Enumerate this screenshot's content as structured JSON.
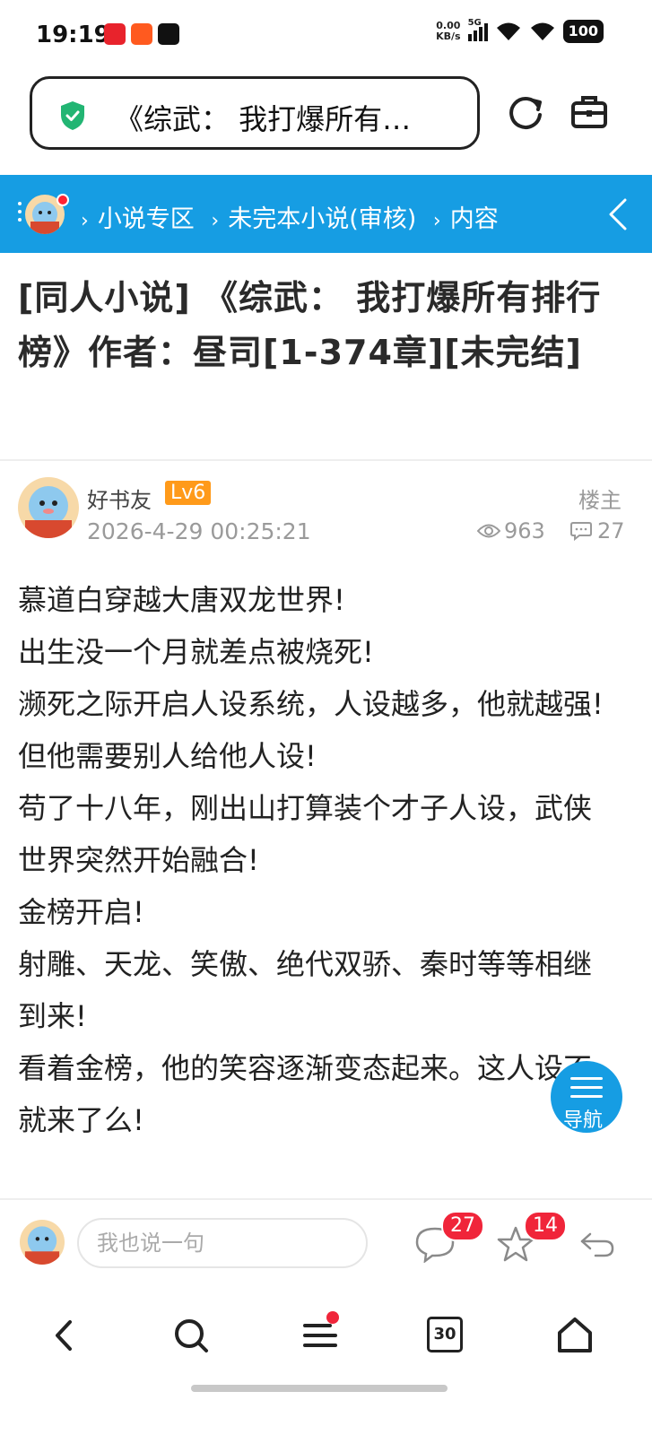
{
  "status": {
    "time": "19:19",
    "net_speed_value": "0.00",
    "net_speed_unit": "KB/s",
    "signal": "5G",
    "battery": "100"
  },
  "address_bar": {
    "url_text": "《综武： 我打爆所有…"
  },
  "breadcrumb": {
    "items": [
      "小说专区",
      "未完本小说(审核)",
      "内容"
    ]
  },
  "post": {
    "title": "[同人小说] 《综武： 我打爆所有排行榜》作者：昼司[1-374章][未完结]",
    "author": "好书友",
    "level": "Lv6",
    "time": "2026-4-29 00:25:21",
    "floor_label": "楼主",
    "views": "963",
    "replies": "27",
    "body_lines": [
      "慕道白穿越大唐双龙世界!",
      "出生没一个月就差点被烧死!",
      "濒死之际开启人设系统，人设越多，他就越强!",
      "但他需要别人给他人设!",
      "苟了十八年，刚出山打算装个才子人设，武侠世界突然开始融合!",
      "金榜开启!",
      "射雕、天龙、笑傲、绝代双骄、秦时等等相继到来!",
      "看着金榜，他的笑容逐渐变态起来。这人设不就来了么!"
    ]
  },
  "floating_nav": {
    "label": "导航"
  },
  "comment_bar": {
    "placeholder": "我也说一句",
    "comment_count": "27",
    "favorite_count": "14"
  },
  "browser_nav": {
    "tabs_count": "30"
  },
  "colors": {
    "accent": "#169de3",
    "level_badge": "#ff9a1a",
    "count_badge": "#f0253a"
  }
}
